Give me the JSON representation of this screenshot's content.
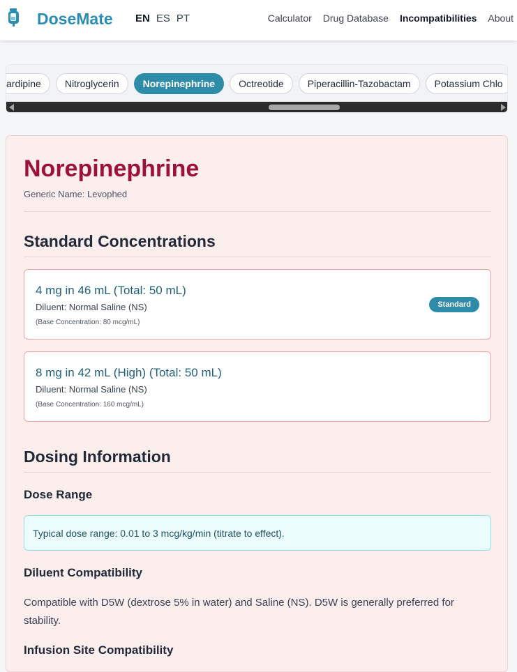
{
  "header": {
    "brand": "DoseMate",
    "languages": [
      "EN",
      "ES",
      "PT"
    ],
    "nav": [
      "Calculator",
      "Drug Database",
      "Incompatibilities",
      "About"
    ]
  },
  "chips": [
    "cardipine",
    "Nitroglycerin",
    "Norepinephrine",
    "Octreotide",
    "Piperacillin-Tazobactam",
    "Potassium Chlo"
  ],
  "drug": {
    "name": "Norepinephrine",
    "generic": "Generic Name: Levophed"
  },
  "sections": {
    "standard_concentrations": "Standard Concentrations",
    "dosing_information": "Dosing Information",
    "dose_range": "Dose Range",
    "diluent_compatibility": "Diluent Compatibility",
    "infusion_site": "Infusion Site Compatibility"
  },
  "concentrations": [
    {
      "title": "4 mg in 46 mL (Total: 50 mL)",
      "diluent": "Diluent: Normal Saline (NS)",
      "base": "(Base Concentration: 80 mcg/mL)",
      "badge": "Standard"
    },
    {
      "title": "8 mg in 42 mL (High) (Total: 50 mL)",
      "diluent": "Diluent: Normal Saline (NS)",
      "base": "(Base Concentration: 160 mcg/mL)"
    }
  ],
  "dose_range_text": "Typical dose range: 0.01 to 3 mcg/kg/min (titrate to effect).",
  "diluent_text": "Compatible with D5W (dextrose 5% in water) and Saline (NS). D5W is generally preferred for stability."
}
